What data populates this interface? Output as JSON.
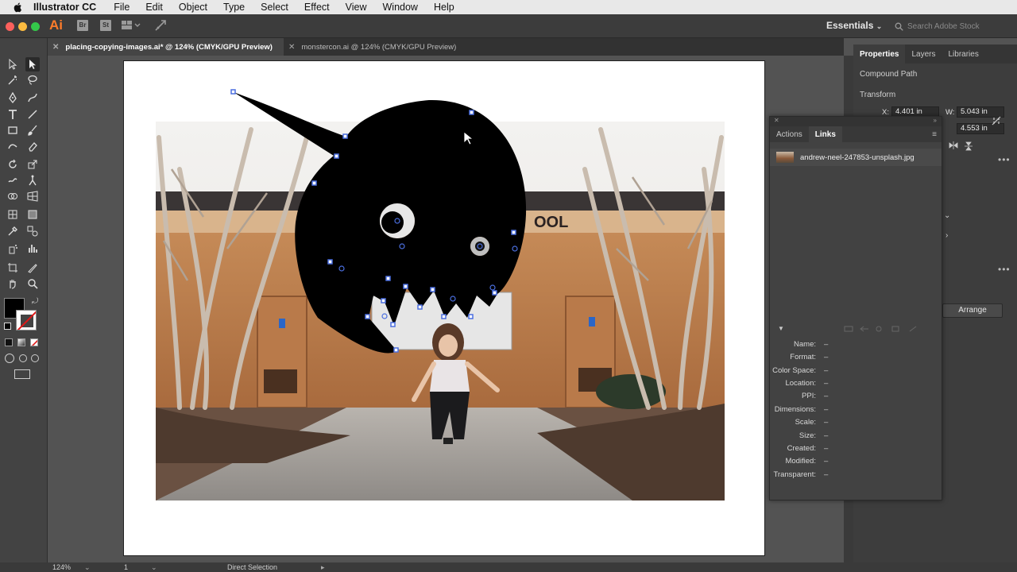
{
  "menubar": {
    "app_name": "Illustrator CC",
    "items": [
      "File",
      "Edit",
      "Object",
      "Type",
      "Select",
      "Effect",
      "View",
      "Window",
      "Help"
    ]
  },
  "appbar": {
    "logo": "Ai",
    "bridge": "Br",
    "stock": "St",
    "workspace": "Essentials",
    "search_placeholder": "Search Adobe Stock"
  },
  "doc_tabs": [
    {
      "label": "placing-copying-images.ai* @ 124% (CMYK/GPU Preview)",
      "active": true
    },
    {
      "label": "monstercon.ai @ 124% (CMYK/GPU Preview)",
      "active": false
    }
  ],
  "photo_sign": "OOL",
  "properties": {
    "tabs": [
      "Properties",
      "Layers",
      "Libraries"
    ],
    "object_type": "Compound Path",
    "transform_label": "Transform",
    "x_label": "X:",
    "x_value": "4.401 in",
    "w_label": "W:",
    "w_value": "5.043 in",
    "h_value": "4.553 in",
    "arrange_button": "Arrange"
  },
  "links_panel": {
    "tabs": [
      "Actions",
      "Links"
    ],
    "file_name": "andrew-neel-247853-unsplash.jpg",
    "info": [
      {
        "label": "Name:",
        "value": "–"
      },
      {
        "label": "Format:",
        "value": "–"
      },
      {
        "label": "Color Space:",
        "value": "–"
      },
      {
        "label": "Location:",
        "value": "–"
      },
      {
        "label": "PPI:",
        "value": "–"
      },
      {
        "label": "Dimensions:",
        "value": "–"
      },
      {
        "label": "Scale:",
        "value": "–"
      },
      {
        "label": "Size:",
        "value": "–"
      },
      {
        "label": "Created:",
        "value": "–"
      },
      {
        "label": "Modified:",
        "value": "–"
      },
      {
        "label": "Transparent:",
        "value": "–"
      }
    ]
  },
  "status": {
    "zoom": "124%",
    "artboard": "1",
    "tool": "Direct Selection"
  },
  "colors": {
    "accent": "#ff7c2a",
    "selection": "#4b6fe0"
  }
}
